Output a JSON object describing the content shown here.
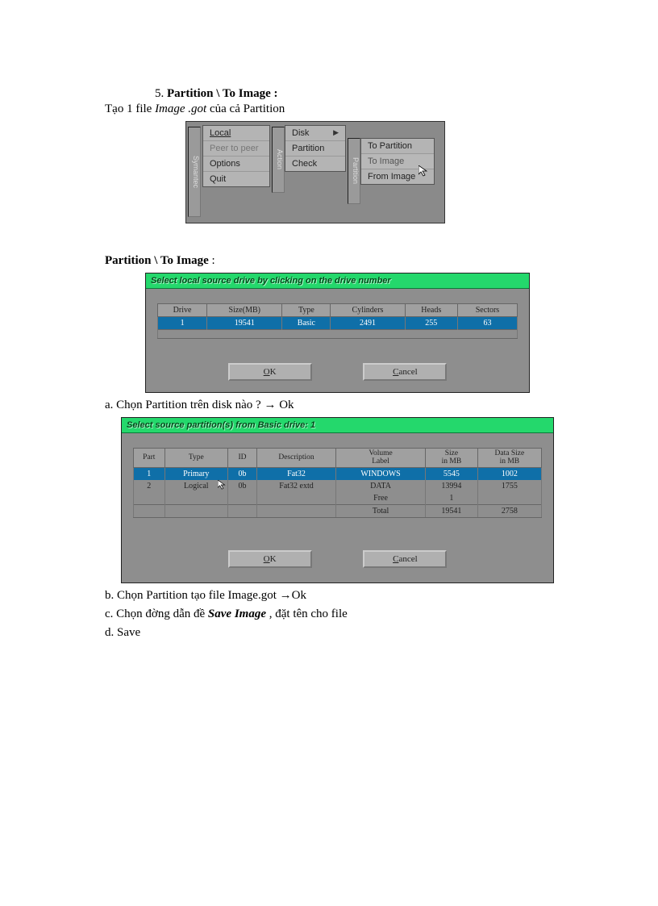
{
  "sec5": {
    "number": "5.",
    "title_bold": "Partition \\ To Image",
    "title_colon": " :",
    "subline_prefix": "Tạo 1 file ",
    "subline_italic": "Image .got",
    "subline_suffix": " của cả Partition"
  },
  "menu": {
    "vtab_left": "Symantec",
    "col1": {
      "items": [
        "Local",
        "Peer to peer",
        "Options",
        "Quit"
      ]
    },
    "vtab_mid": "Action",
    "col2": {
      "items": [
        "Disk",
        "Partition",
        "Check"
      ]
    },
    "vtab_right": "Partition",
    "col3": {
      "items": [
        "To Partition",
        "To Image",
        "From Image"
      ]
    }
  },
  "section2_head": "Partition \\ To Image",
  "section2_colon": " :",
  "dlg1": {
    "title": "Select local source drive by clicking on the drive number",
    "headers": [
      "Drive",
      "Size(MB)",
      "Type",
      "Cylinders",
      "Heads",
      "Sectors"
    ],
    "row": [
      "1",
      "19541",
      "Basic",
      "2491",
      "255",
      "63"
    ],
    "ok": "OK",
    "cancel": "Cancel"
  },
  "step_a": {
    "prefix": "a. Chọn Partition trên disk nào ? ",
    "arrow": "→",
    "suffix": " Ok"
  },
  "dlg2": {
    "title": "Select source partition(s) from Basic drive: 1",
    "headers": [
      "Part",
      "Type",
      "ID",
      "Description",
      "Volume\nLabel",
      "Size\nin MB",
      "Data Size\nin MB"
    ],
    "row1": [
      "1",
      "Primary",
      "0b",
      "Fat32",
      "WINDOWS",
      "5545",
      "1002"
    ],
    "row2": [
      "2",
      "Logical",
      "0b",
      "Fat32 extd",
      "DATA",
      "13994",
      "1755"
    ],
    "row3": [
      "",
      "",
      "",
      "",
      "Free",
      "1",
      ""
    ],
    "total_label": "Total",
    "total_size": "19541",
    "total_data": "2758",
    "ok": "OK",
    "cancel": "Cancel"
  },
  "step_b": {
    "prefix": "b. Chọn Partition tạo file Image.got ",
    "arrow": "→",
    "suffix": "Ok"
  },
  "step_c": {
    "prefix": "c. Chọn đờng  dẫn đề ",
    "italic": "Save Image",
    "suffix": " , đặt tên cho file"
  },
  "step_d": "d. Save"
}
